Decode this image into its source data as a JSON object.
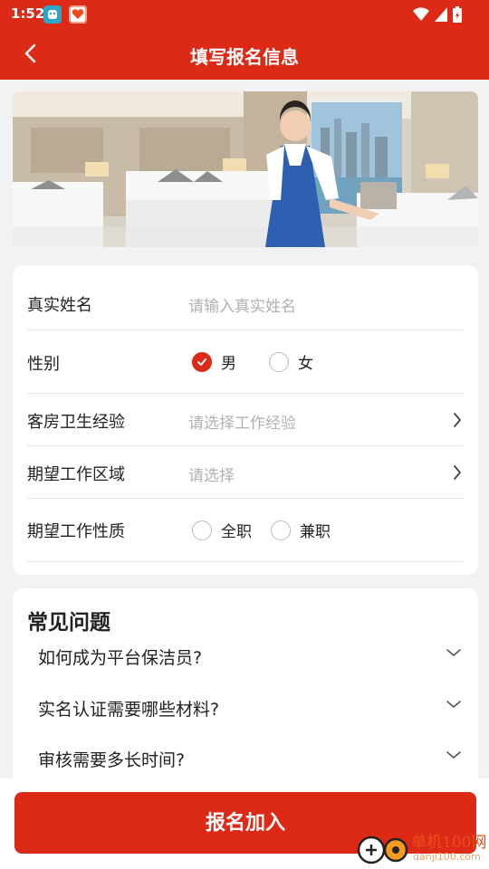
{
  "status_bar": {
    "time": "1:52"
  },
  "header": {
    "title": "填写报名信息"
  },
  "form": {
    "name": {
      "label": "真实姓名",
      "placeholder": "请输入真实姓名"
    },
    "gender": {
      "label": "性别",
      "options": [
        "男",
        "女"
      ],
      "selected": "男"
    },
    "experience": {
      "label": "客房卫生经验",
      "placeholder": "请选择工作经验"
    },
    "region": {
      "label": "期望工作区域",
      "placeholder": "请选择"
    },
    "job_type": {
      "label": "期望工作性质",
      "options": [
        "全职",
        "兼职"
      ],
      "selected": ""
    }
  },
  "faq": {
    "title": "常见问题",
    "items": [
      "如何成为平台保洁员?",
      "实名认证需要哪些材料?",
      "审核需要多长时间?"
    ]
  },
  "submit_label": "报名加入",
  "watermark": {
    "brand": "单机100网",
    "url": "danji100.com"
  },
  "colors": {
    "accent": "#dc2a17",
    "placeholder": "#b0b0b5"
  }
}
